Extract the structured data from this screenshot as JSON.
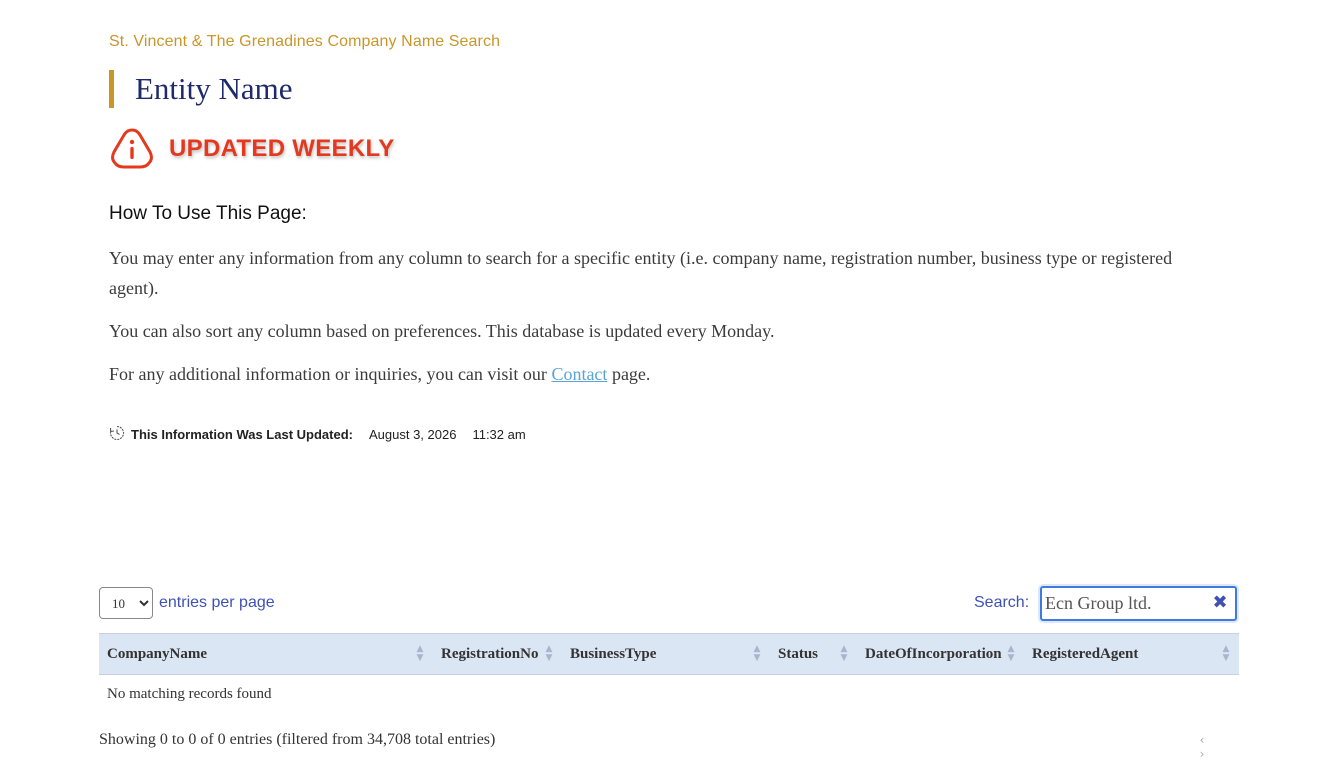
{
  "header": {
    "site_title": "St. Vincent & The Grenadines Company Name Search",
    "page_title": "Entity Name",
    "notice": "UPDATED WEEKLY"
  },
  "howto": {
    "heading": "How To Use This Page:",
    "p1": "You may enter any information from any column to search for a specific entity (i.e. company name, registration number, business type or registered agent).",
    "p2": "You can also sort any column based on preferences. This database is updated every Monday.",
    "p3_before": "For any additional information or inquiries, you can visit our",
    "p3_link": "Contact",
    "p3_after": "page."
  },
  "last_updated": {
    "label": "This Information Was Last Updated:",
    "date": "August 3, 2026",
    "time": "11:32 am"
  },
  "table_controls": {
    "page_length": "10",
    "page_length_options": [
      "10"
    ],
    "entries_label": "entries per page",
    "search_label": "Search:",
    "search_value": "Ecn Group ltd."
  },
  "table": {
    "columns": [
      "CompanyName",
      "RegistrationNo",
      "BusinessType",
      "Status",
      "DateOfIncorporation",
      "RegisteredAgent"
    ],
    "empty_message": "No matching records found",
    "info": "Showing 0 to 0 of 0 entries (filtered from 34,708 total entries)"
  },
  "pager": {
    "prev": "‹",
    "next": "›"
  },
  "colors": {
    "accent_gold": "#c9962a",
    "title_navy": "#1f2a6b",
    "notice_red": "#e5391f",
    "link_blue": "#5ba3d6",
    "control_blue": "#3f51b5",
    "header_row_bg": "#dbe6f4"
  },
  "icons": {
    "notice": "alert-info-icon",
    "clock": "clock-history-icon",
    "clear": "close-icon",
    "sort": "sort-arrows-icon"
  }
}
